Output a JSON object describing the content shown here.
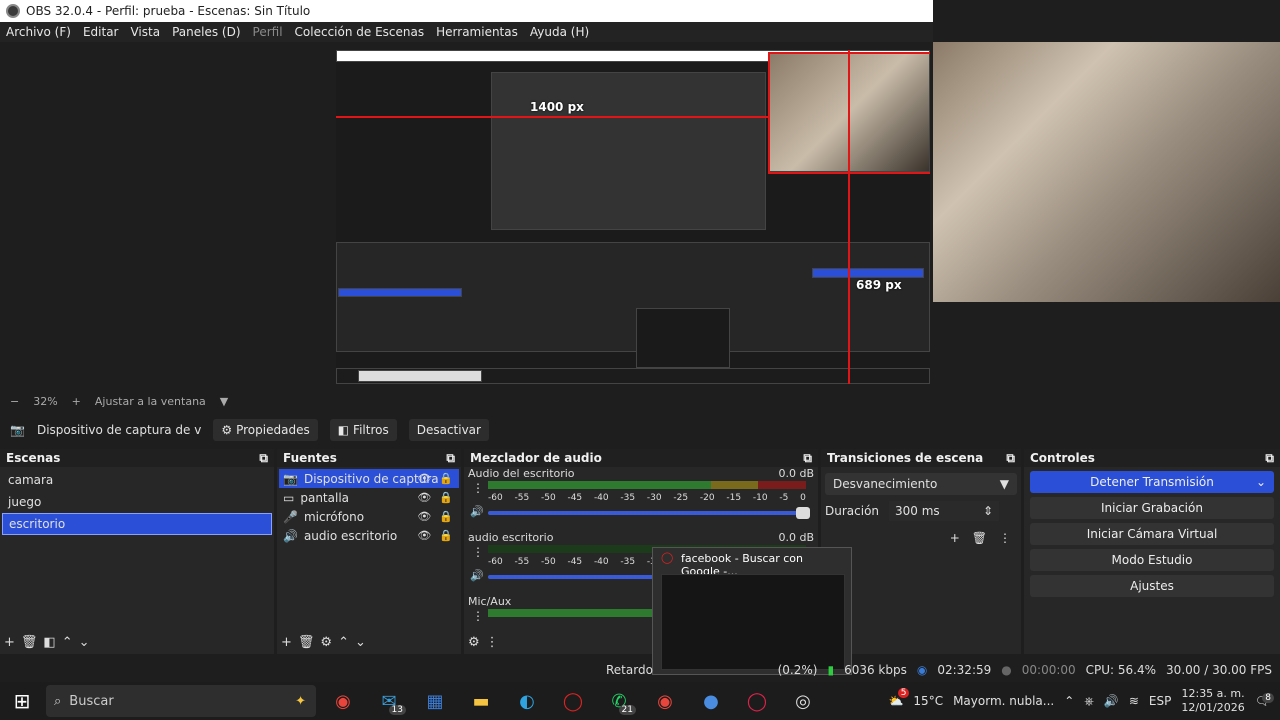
{
  "window": {
    "title": "OBS 32.0.4 - Perfil: prueba - Escenas: Sin Título"
  },
  "menu": [
    {
      "label": "Archivo (F)",
      "disabled": false
    },
    {
      "label": "Editar",
      "disabled": false
    },
    {
      "label": "Vista",
      "disabled": false
    },
    {
      "label": "Paneles (D)",
      "disabled": false
    },
    {
      "label": "Perfil",
      "disabled": true
    },
    {
      "label": "Colección de Escenas",
      "disabled": false
    },
    {
      "label": "Herramientas",
      "disabled": false
    },
    {
      "label": "Ayuda (H)",
      "disabled": false
    }
  ],
  "preview": {
    "measure_width": "1400 px",
    "measure_height": "689 px",
    "nested_popup": "facebook - Buscar con Google",
    "nested_search": "Buscar",
    "nested_weather": "15°C Mayorm. nubla..."
  },
  "zoom": {
    "percent": "32%",
    "fit_label": "Ajustar a la ventana"
  },
  "source_toolbar": {
    "source_name": "Dispositivo de captura de v",
    "properties": "Propiedades",
    "filters": "Filtros",
    "deactivate": "Desactivar"
  },
  "scenes": {
    "title": "Escenas",
    "items": [
      "camara",
      "juego",
      "escritorio"
    ],
    "selected": "escritorio"
  },
  "sources": {
    "title": "Fuentes",
    "items": [
      {
        "name": "Dispositivo de captura",
        "icon": "camera-icon",
        "selected": true
      },
      {
        "name": "pantalla",
        "icon": "monitor-icon",
        "selected": false
      },
      {
        "name": "micrófono",
        "icon": "microphone-icon",
        "selected": false
      },
      {
        "name": "audio escritorio",
        "icon": "speaker-icon",
        "selected": false
      }
    ]
  },
  "mixer": {
    "title": "Mezclador de audio",
    "ticks": [
      "-60",
      "-55",
      "-50",
      "-45",
      "-40",
      "-35",
      "-30",
      "-25",
      "-20",
      "-15",
      "-10",
      "-5",
      "0"
    ],
    "channels": [
      {
        "name": "Audio del escritorio",
        "db": "0.0 dB",
        "level": 0.72
      },
      {
        "name": "audio escritorio",
        "db": "0.0 dB",
        "level": 0.0
      },
      {
        "name": "Mic/Aux",
        "db": "",
        "level": 0.55
      }
    ]
  },
  "transitions": {
    "title": "Transiciones de escena",
    "selected": "Desvanecimiento",
    "duration_label": "Duración",
    "duration_value": "300 ms"
  },
  "controls": {
    "title": "Controles",
    "stop_stream": "Detener Transmisión",
    "start_recording": "Iniciar Grabación",
    "virtual_camera": "Iniciar Cámara Virtual",
    "studio_mode": "Modo Estudio",
    "settings": "Ajustes"
  },
  "popup": {
    "title": "facebook - Buscar con Google -..."
  },
  "status": {
    "delay": "Retardo",
    "dropped": "(0.2%)",
    "bitrate": "6036 kbps",
    "stream_time": "02:32:59",
    "rec_time": "00:00:00",
    "cpu": "CPU: 56.4%",
    "fps": "30.00 / 30.00 FPS"
  },
  "taskbar": {
    "search_placeholder": "Buscar",
    "apps": [
      {
        "name": "chrome-icon",
        "badge": ""
      },
      {
        "name": "mail-icon",
        "badge": "13"
      },
      {
        "name": "store-icon",
        "badge": ""
      },
      {
        "name": "explorer-icon",
        "badge": ""
      },
      {
        "name": "edge-icon",
        "badge": ""
      },
      {
        "name": "opera-icon",
        "badge": ""
      },
      {
        "name": "whatsapp-icon",
        "badge": "21"
      },
      {
        "name": "chrome-alt-icon",
        "badge": ""
      },
      {
        "name": "browser-icon",
        "badge": ""
      },
      {
        "name": "opera-gx-icon",
        "badge": ""
      },
      {
        "name": "obs-icon",
        "badge": ""
      }
    ],
    "weather_badge": "5",
    "weather": "15°C",
    "weather_desc": "Mayorm. nubla...",
    "language": "ESP",
    "time": "12:35 a. m.",
    "date": "12/01/2026",
    "notifications": "8"
  }
}
